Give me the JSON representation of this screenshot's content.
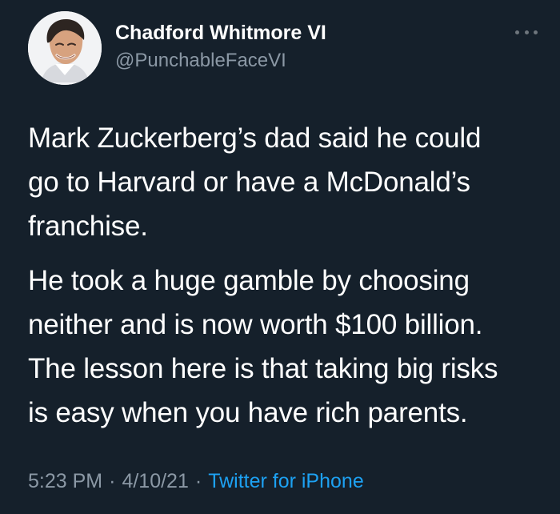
{
  "author": {
    "display_name": "Chadford Whitmore VI",
    "handle": "@PunchableFaceVI",
    "avatar_icon": "profile-photo-man"
  },
  "tweet": {
    "paragraphs": [
      "Mark Zuckerberg’s dad said he could go to Harvard or have a McDonald’s franchise.",
      "He took a huge gamble by choosing neither and is now worth $100 billion. The lesson here is that taking big risks is easy when you have rich parents."
    ],
    "lines": [
      [
        "Mark Zuckerberg’s dad said he could",
        "go to Harvard or have a McDonald’s",
        "franchise."
      ],
      [
        "He took a huge gamble by choosing",
        "neither and is now worth $100 billion.",
        "The lesson here is that taking big risks",
        "is easy when you have rich parents."
      ]
    ]
  },
  "meta": {
    "time": "5:23 PM",
    "date": "4/10/21",
    "separator": "·",
    "source": "Twitter for iPhone"
  },
  "icons": {
    "more": "more-options-icon"
  },
  "colors": {
    "background": "#15202b",
    "text": "#ffffff",
    "secondary_text": "#8b98a5",
    "link": "#1da1f2"
  }
}
